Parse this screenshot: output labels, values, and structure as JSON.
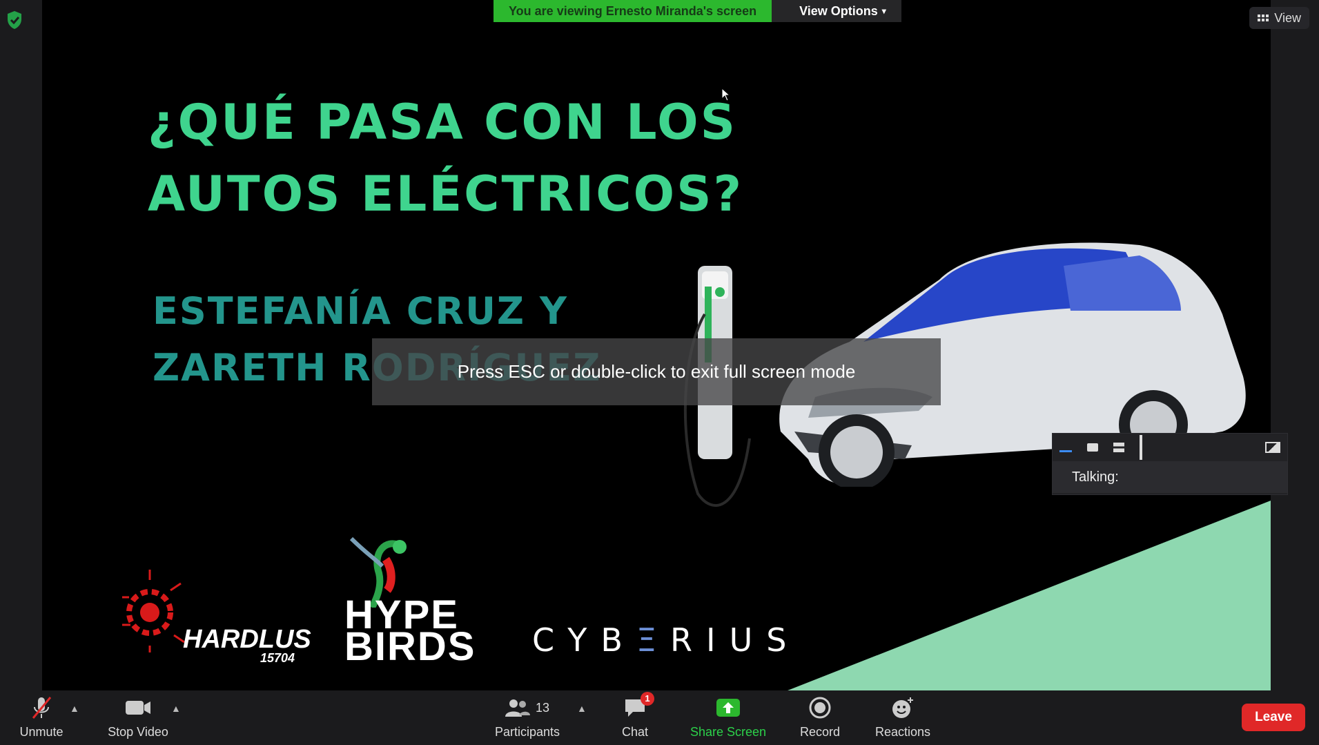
{
  "banner": {
    "viewing_text": "You are viewing Ernesto Miranda's screen",
    "view_options_label": "View Options"
  },
  "view_button": {
    "label": "View"
  },
  "slide": {
    "title_line1": "¿QUÉ PASA CON LOS",
    "title_line2": "AUTOS ELÉCTRICOS?",
    "authors_line1": "ESTEFANÍA CRUZ Y",
    "authors_line2": "ZARETH RODRÍGUEZ",
    "logo_hardlus": "HARDLUS",
    "logo_hardlus_num": "15704",
    "logo_birds": "HYPE BIRDS",
    "logo_cyberius_a": "CYB",
    "logo_cyberius_e": "Ξ",
    "logo_cyberius_b": "RIUS"
  },
  "overlay": {
    "esc_message": "Press ESC or double-click to exit full screen mode"
  },
  "talk_panel": {
    "talking_label": "Talking:"
  },
  "toolbar": {
    "unmute": "Unmute",
    "stop_video": "Stop Video",
    "participants": "Participants",
    "participants_count": "13",
    "chat": "Chat",
    "chat_badge": "1",
    "share_screen": "Share Screen",
    "record": "Record",
    "reactions": "Reactions",
    "leave": "Leave"
  },
  "colors": {
    "title": "#3fd48e",
    "authors": "#23958c",
    "share_green": "#2cb82e",
    "leave_red": "#e02828",
    "triangle": "#8ed8b0"
  },
  "icons": [
    "shield-icon",
    "grid-icon",
    "mic-muted-icon",
    "video-icon",
    "participants-icon",
    "chat-icon",
    "share-icon",
    "record-icon",
    "reactions-icon"
  ]
}
